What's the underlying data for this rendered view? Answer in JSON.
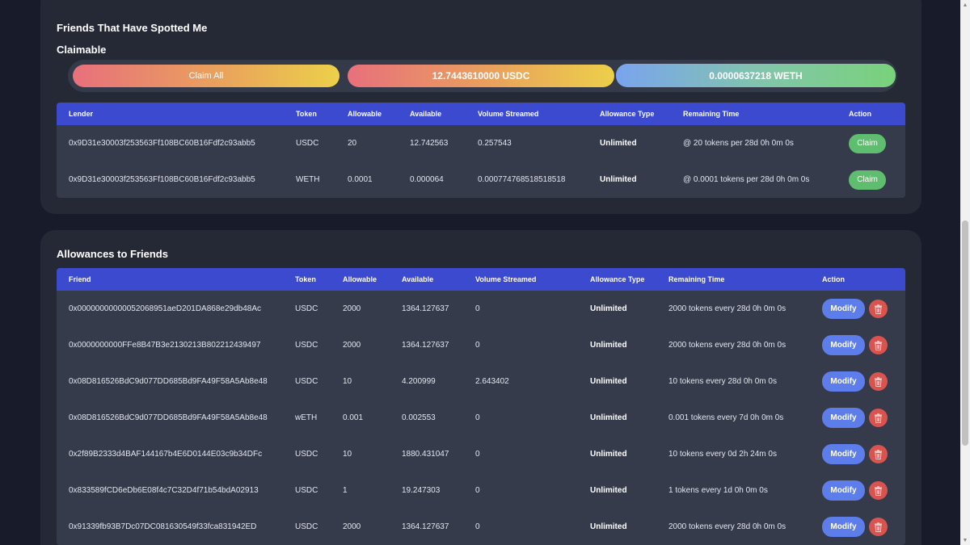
{
  "spotted": {
    "title": "Friends That Have Spotted Me",
    "subtitle": "Claimable",
    "claim_all_label": "Claim All",
    "usdc_total": "12.7443610000 USDC",
    "weth_total": "0.0000637218 WETH",
    "columns": [
      "Lender",
      "Token",
      "Allowable",
      "Available",
      "Volume Streamed",
      "Allowance Type",
      "Remaining Time",
      "Action"
    ],
    "rows": [
      {
        "lender": "0x9D31e30003f253563Ff108BC60B16Fdf2c93abb5",
        "token": "USDC",
        "allowable": "20",
        "available": "12.742563",
        "volume": "0.257543",
        "type": "Unlimited",
        "remaining": "@ 20 tokens per 28d 0h 0m 0s",
        "action": "Claim"
      },
      {
        "lender": "0x9D31e30003f253563Ff108BC60B16Fdf2c93abb5",
        "token": "WETH",
        "allowable": "0.0001",
        "available": "0.000064",
        "volume": "0.000774768518518518",
        "type": "Unlimited",
        "remaining": "@ 0.0001 tokens per 28d 0h 0m 0s",
        "action": "Claim"
      }
    ]
  },
  "allowances": {
    "title": "Allowances to Friends",
    "columns": [
      "Friend",
      "Token",
      "Allowable",
      "Available",
      "Volume Streamed",
      "Allowance Type",
      "Remaining Time",
      "Action"
    ],
    "modify_label": "Modify",
    "delete_icon": "trash-icon",
    "rows": [
      {
        "friend": "0x00000000000052068951aeD201DA868e29db48Ac",
        "token": "USDC",
        "allowable": "2000",
        "available": "1364.127637",
        "volume": "0",
        "type": "Unlimited",
        "remaining": "2000 tokens every 28d 0h 0m 0s"
      },
      {
        "friend": "0x0000000000FFe8B47B3e2130213B802212439497",
        "token": "USDC",
        "allowable": "2000",
        "available": "1364.127637",
        "volume": "0",
        "type": "Unlimited",
        "remaining": "2000 tokens every 28d 0h 0m 0s"
      },
      {
        "friend": "0x08D816526BdC9d077DD685Bd9FA49F58A5Ab8e48",
        "token": "USDC",
        "allowable": "10",
        "available": "4.200999",
        "volume": "2.643402",
        "type": "Unlimited",
        "remaining": "10 tokens every 28d 0h 0m 0s"
      },
      {
        "friend": "0x08D816526BdC9d077DD685Bd9FA49F58A5Ab8e48",
        "token": "wETH",
        "allowable": "0.001",
        "available": "0.002553",
        "volume": "0",
        "type": "Unlimited",
        "remaining": "0.001 tokens every 7d 0h 0m 0s"
      },
      {
        "friend": "0x2f89B2333d4BAF144167b4E6D0144E03c9b34DFc",
        "token": "USDC",
        "allowable": "10",
        "available": "1880.431047",
        "volume": "0",
        "type": "Unlimited",
        "remaining": "10 tokens every 0d 2h 24m 0s"
      },
      {
        "friend": "0x833589fCD6eDb6E08f4c7C32D4f71b54bdA02913",
        "token": "USDC",
        "allowable": "1",
        "available": "19.247303",
        "volume": "0",
        "type": "Unlimited",
        "remaining": "1 tokens every 1d 0h 0m 0s"
      },
      {
        "friend": "0x91339fb93B7Dc07DC081630549f33fca831942ED",
        "token": "USDC",
        "allowable": "2000",
        "available": "1364.127637",
        "volume": "0",
        "type": "Unlimited",
        "remaining": "2000 tokens every 28d 0h 0m 0s"
      }
    ]
  },
  "colors": {
    "background": "#181c2a",
    "card": "#252936",
    "table_header": "#3c4ad0",
    "claim_button": "#5ebd6e",
    "modify_button": "#5d7dea",
    "delete_button": "#d9534f"
  }
}
